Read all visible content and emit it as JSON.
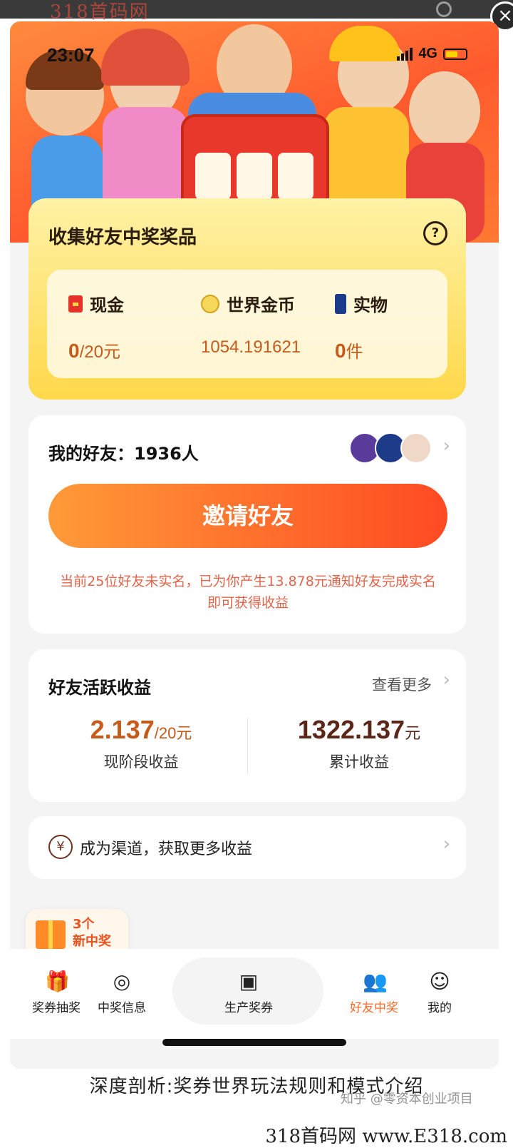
{
  "topbar": {
    "watermark": "318首码网"
  },
  "status": {
    "time": "23:07",
    "network": "4G"
  },
  "prizes": {
    "title": "收集好友中奖奖品",
    "items": [
      {
        "label": "现金",
        "value": "0",
        "unit": "/20元",
        "icon": "red-envelope-icon"
      },
      {
        "label": "世界金币",
        "value": "1054.191621",
        "unit": "",
        "icon": "coin-icon"
      },
      {
        "label": "实物",
        "value": "0",
        "unit": "件",
        "icon": "phone-icon"
      }
    ]
  },
  "friends": {
    "label": "我的好友：1936人",
    "invite_button": "邀请好友",
    "notice": "当前25位好友未实名，已为你产生13.878元通知好友完成实名即可获得收益"
  },
  "earnings": {
    "title": "好友活跃收益",
    "more": "查看更多",
    "stage_value": "2.137",
    "stage_unit": "/20元",
    "stage_label": "现阶段收益",
    "total_value": "1322.137",
    "total_unit": "元",
    "total_label": "累计收益"
  },
  "channel": {
    "icon_glyph": "¥",
    "label": "成为渠道，获取更多收益"
  },
  "gift_badge": {
    "count": "3个",
    "label": "新中奖"
  },
  "tabs": [
    {
      "label": "奖券抽奖",
      "icon": "gift-icon"
    },
    {
      "label": "中奖信息",
      "icon": "camera-icon"
    },
    {
      "label": "生产奖券",
      "icon": "robot-icon"
    },
    {
      "label": "好友中奖",
      "icon": "friends-icon"
    },
    {
      "label": "我的",
      "icon": "face-icon"
    }
  ],
  "caption": "深度剖析:奖券世界玩法规则和模式介绍",
  "zhihu_watermark": "知乎 @零资本创业项目",
  "footer_watermark": "318首码网 www.E318.com",
  "colors": {
    "accent": "#ff5a2e",
    "gold": "#ffd84a",
    "earning": "#c65a1a"
  }
}
